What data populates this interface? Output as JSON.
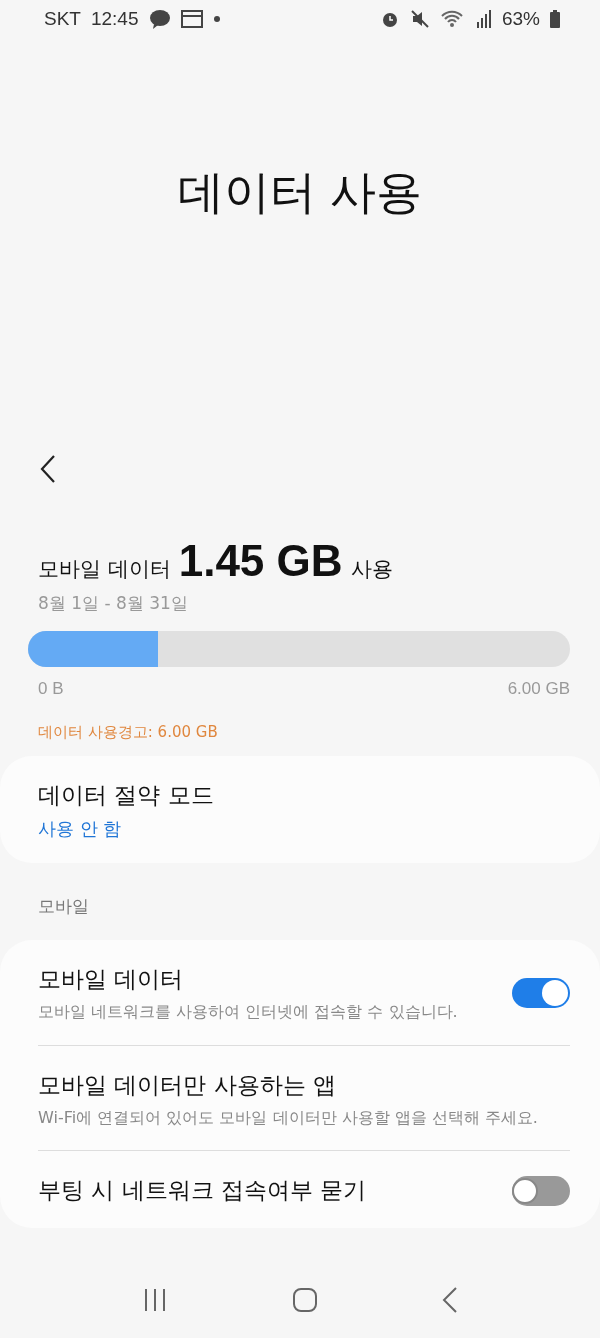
{
  "status_bar": {
    "carrier": "SKT",
    "time": "12:45",
    "battery": "63%"
  },
  "title": "데이터 사용",
  "usage": {
    "label": "모바일 데이터",
    "amount": "1.45 GB",
    "suffix": "사용",
    "period": "8월 1일 - 8월 31일",
    "level": 0.24,
    "min": "0 B",
    "max": "6.00 GB",
    "warning": "데이터 사용경고: 6.00 GB"
  },
  "saver": {
    "title": "데이터 절약 모드",
    "value": "사용 안 함"
  },
  "section": "모바일",
  "settings": [
    {
      "title": "모바일 데이터",
      "subtitle": "모바일 네트워크를 사용하여 인터넷에 접속할 수 있습니다.",
      "kind": "toggle",
      "on": true
    },
    {
      "title": "모바일 데이터만 사용하는 앱",
      "subtitle": "Wi-Fi에 연결되어 있어도 모바일 데이터만 사용할 앱을 선택해 주세요.",
      "kind": "link"
    },
    {
      "title": "부팅 시 네트워크 접속여부 묻기",
      "kind": "toggle",
      "on": false
    }
  ]
}
